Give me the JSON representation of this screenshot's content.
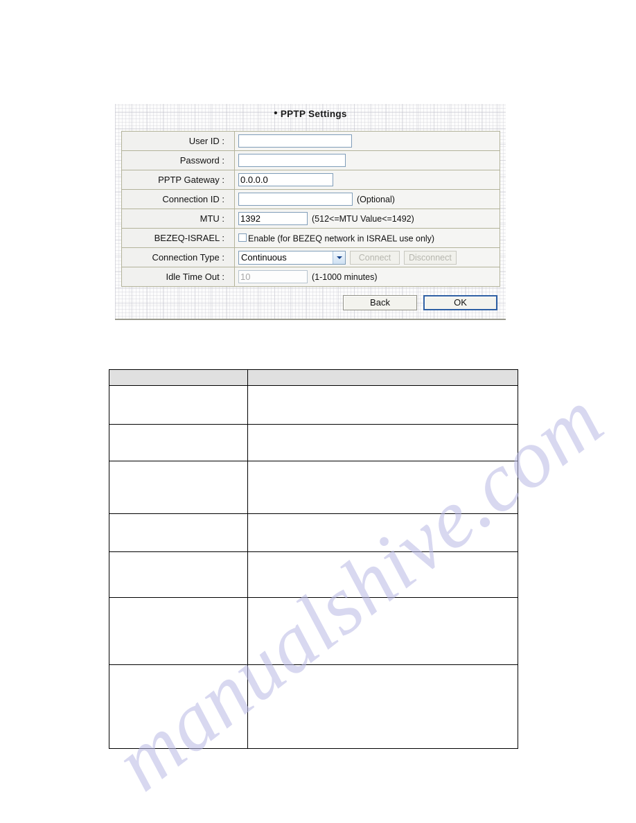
{
  "panel": {
    "bullet": "•",
    "title": "PPTP Settings",
    "rows": [
      {
        "label": "User ID :",
        "value": "",
        "hint": ""
      },
      {
        "label": "Password :",
        "value": "",
        "hint": ""
      },
      {
        "label": "PPTP Gateway :",
        "value": "0.0.0.0",
        "hint": ""
      },
      {
        "label": "Connection ID :",
        "value": "",
        "hint": "(Optional)"
      },
      {
        "label": "MTU :",
        "value": "1392",
        "hint": "(512<=MTU Value<=1492)"
      },
      {
        "label": "BEZEQ-ISRAEL :",
        "value": "",
        "hint": ""
      },
      {
        "label": "Connection Type :",
        "value": "",
        "hint": ""
      },
      {
        "label": "Idle Time Out :",
        "value": "10",
        "hint": "(1-1000 minutes)"
      }
    ],
    "bezeq": {
      "checkbox_label": "Enable (for BEZEQ network in ISRAEL use only)",
      "checked": false
    },
    "connection_type": {
      "selected": "Continuous",
      "connect_label": "Connect",
      "disconnect_label": "Disconnect",
      "connect_enabled": false,
      "disconnect_enabled": false
    },
    "buttons": {
      "back_label": "Back",
      "ok_label": "OK"
    }
  },
  "description_table": {
    "headers": [
      "",
      ""
    ],
    "rows": [
      {
        "cells": [
          "",
          ""
        ]
      },
      {
        "cells": [
          "",
          ""
        ]
      },
      {
        "cells": [
          "",
          ""
        ]
      },
      {
        "cells": [
          "",
          ""
        ]
      },
      {
        "cells": [
          "",
          ""
        ]
      },
      {
        "cells": [
          "",
          ""
        ]
      },
      {
        "cells": [
          "",
          ""
        ]
      }
    ]
  },
  "watermark": {
    "text": "manualshive.com"
  },
  "colors": {
    "panel_border": "#b3b39a",
    "label_cell_bg": "#f1f1ef",
    "value_cell_bg": "#f5f5f3",
    "input_border": "#7f9db9",
    "table_header_bg": "#e0e0e0",
    "focus_border": "#2e5fa3",
    "watermark": "#b9b9e4"
  }
}
